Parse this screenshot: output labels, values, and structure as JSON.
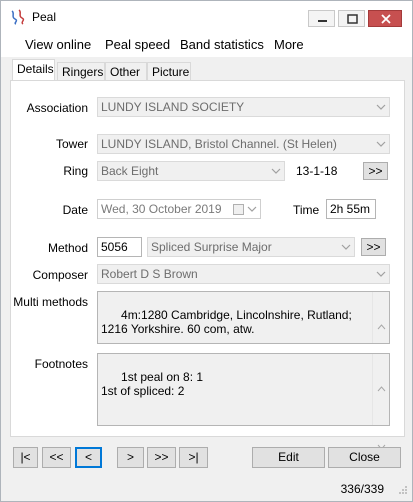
{
  "window": {
    "title": "Peal"
  },
  "menu": [
    "View online",
    "Peal speed",
    "Band statistics",
    "More"
  ],
  "tabs": [
    "Details",
    "Ringers",
    "Other",
    "Picture"
  ],
  "details": {
    "association_label": "Association",
    "association_value": "LUNDY ISLAND SOCIETY",
    "tower_label": "Tower",
    "tower_value": "LUNDY ISLAND, Bristol Channel. (St Helen)",
    "ring_label": "Ring",
    "ring_value": "Back Eight",
    "ring_weight": "13-1-18",
    "ring_more_label": ">>",
    "date_label": "Date",
    "date_value": "Wed, 30  October  2019",
    "time_label": "Time",
    "time_value": "2h 55m",
    "method_label": "Method",
    "method_changes": "5056",
    "method_value": "Spliced Surprise Major",
    "method_more_label": ">>",
    "composer_label": "Composer",
    "composer_value": "Robert D S Brown",
    "multi_methods_label": "Multi methods",
    "multi_methods_value": "4m:1280 Cambridge, Lincolnshire, Rutland; 1216 Yorkshire. 60 com, atw.",
    "footnotes_label": "Footnotes",
    "footnotes_value": "1st peal on 8: 1\n1st of spliced: 2"
  },
  "nav": {
    "first": "|<",
    "prev_page": "<<",
    "prev": "<",
    "next": ">",
    "next_page": ">>",
    "last": ">|",
    "edit": "Edit",
    "close": "Close"
  },
  "status": {
    "counter": "336/339"
  },
  "colors": {
    "accent_focus": "#0078d7",
    "close_button": "#c75050"
  }
}
